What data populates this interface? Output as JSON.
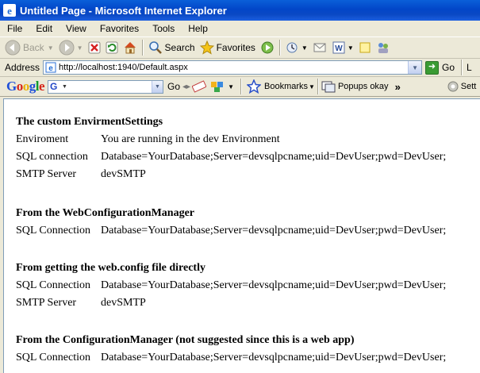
{
  "window": {
    "title": "Untitled Page - Microsoft Internet Explorer"
  },
  "menu": [
    "File",
    "Edit",
    "View",
    "Favorites",
    "Tools",
    "Help"
  ],
  "toolbar": {
    "back": "Back",
    "search": "Search",
    "favorites": "Favorites"
  },
  "address": {
    "label": "Address",
    "url": "http://localhost:1940/Default.aspx",
    "go": "Go",
    "links": "L"
  },
  "google": {
    "go": "Go",
    "bookmarks": "Bookmarks",
    "popups": "Popups okay",
    "more": "»",
    "settings": "Sett"
  },
  "page": {
    "s1": {
      "title": "The custom EnvirmentSettings",
      "rows": [
        {
          "k": "Enviroment",
          "v": "You are running in the dev Environment"
        },
        {
          "k": "SQL connection",
          "v": "Database=YourDatabase;Server=devsqlpcname;uid=DevUser;pwd=DevUser;"
        },
        {
          "k": "SMTP Server",
          "v": "devSMTP"
        }
      ]
    },
    "s2": {
      "title": "From the WebConfigurationManager",
      "rows": [
        {
          "k": "SQL Connection",
          "v": "Database=YourDatabase;Server=devsqlpcname;uid=DevUser;pwd=DevUser;"
        }
      ]
    },
    "s3": {
      "title": "From getting the web.config file directly",
      "rows": [
        {
          "k": "SQL Connection",
          "v": "Database=YourDatabase;Server=devsqlpcname;uid=DevUser;pwd=DevUser;"
        },
        {
          "k": "SMTP Server",
          "v": "devSMTP"
        }
      ]
    },
    "s4": {
      "title": "From the ConfigurationManager (not suggested since this is a web app)",
      "rows": [
        {
          "k": "SQL Connection",
          "v": "Database=YourDatabase;Server=devsqlpcname;uid=DevUser;pwd=DevUser;"
        }
      ]
    }
  }
}
